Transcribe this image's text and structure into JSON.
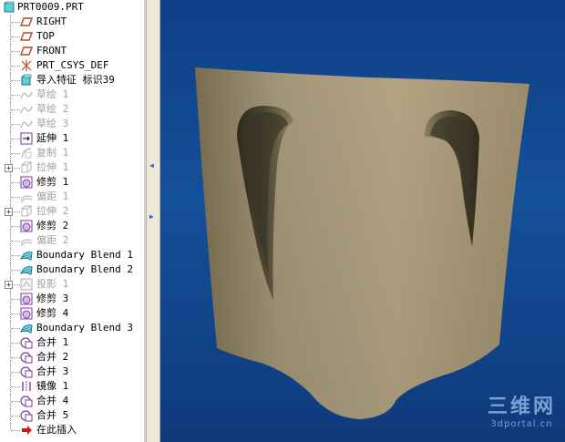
{
  "model_tree": {
    "root": "PRT0009.PRT",
    "items": [
      {
        "label": "RIGHT",
        "icon": "datum-plane-icon",
        "suppressed": false,
        "expandable": false
      },
      {
        "label": "TOP",
        "icon": "datum-plane-icon",
        "suppressed": false,
        "expandable": false
      },
      {
        "label": "FRONT",
        "icon": "datum-plane-icon",
        "suppressed": false,
        "expandable": false
      },
      {
        "label": "PRT_CSYS_DEF",
        "icon": "csys-icon",
        "suppressed": false,
        "expandable": false
      },
      {
        "label": "导入特征 标识39",
        "icon": "import-feature-icon",
        "suppressed": false,
        "expandable": false
      },
      {
        "label": "草绘 1",
        "icon": "sketch-icon",
        "suppressed": true,
        "expandable": false
      },
      {
        "label": "草绘 2",
        "icon": "sketch-icon",
        "suppressed": true,
        "expandable": false
      },
      {
        "label": "草绘 3",
        "icon": "sketch-icon",
        "suppressed": true,
        "expandable": false
      },
      {
        "label": "延伸 1",
        "icon": "extend-icon",
        "suppressed": false,
        "expandable": false
      },
      {
        "label": "复制 1",
        "icon": "copy-icon",
        "suppressed": true,
        "expandable": false
      },
      {
        "label": "拉伸 1",
        "icon": "extrude-icon",
        "suppressed": true,
        "expandable": true
      },
      {
        "label": "修剪 1",
        "icon": "trim-icon",
        "suppressed": false,
        "expandable": false
      },
      {
        "label": "偏距 1",
        "icon": "offset-icon",
        "suppressed": true,
        "expandable": false
      },
      {
        "label": "拉伸 2",
        "icon": "extrude-icon",
        "suppressed": true,
        "expandable": true
      },
      {
        "label": "修剪 2",
        "icon": "trim-icon",
        "suppressed": false,
        "expandable": false
      },
      {
        "label": "偏距 2",
        "icon": "offset-icon",
        "suppressed": true,
        "expandable": false
      },
      {
        "label": "Boundary Blend 1",
        "icon": "boundary-blend-icon",
        "suppressed": false,
        "expandable": false
      },
      {
        "label": "Boundary Blend 2",
        "icon": "boundary-blend-icon",
        "suppressed": false,
        "expandable": false
      },
      {
        "label": "投影 1",
        "icon": "project-icon",
        "suppressed": true,
        "expandable": true
      },
      {
        "label": "修剪 3",
        "icon": "trim-icon",
        "suppressed": false,
        "expandable": false
      },
      {
        "label": "修剪 4",
        "icon": "trim-icon",
        "suppressed": false,
        "expandable": false
      },
      {
        "label": "Boundary Blend 3",
        "icon": "boundary-blend-icon",
        "suppressed": false,
        "expandable": false
      },
      {
        "label": "合并 1",
        "icon": "merge-icon",
        "suppressed": false,
        "expandable": false
      },
      {
        "label": "合并 2",
        "icon": "merge-icon",
        "suppressed": false,
        "expandable": false
      },
      {
        "label": "合并 3",
        "icon": "merge-icon",
        "suppressed": false,
        "expandable": false
      },
      {
        "label": "镜像 1",
        "icon": "mirror-icon",
        "suppressed": false,
        "expandable": false
      },
      {
        "label": "合并 4",
        "icon": "merge-icon",
        "suppressed": false,
        "expandable": false
      },
      {
        "label": "合并 5",
        "icon": "merge-icon",
        "suppressed": false,
        "expandable": false
      },
      {
        "label": "在此插入",
        "icon": "insert-here-icon",
        "suppressed": false,
        "expandable": false
      }
    ]
  },
  "watermark": {
    "big": "三维网",
    "small": "3dportal.cn"
  },
  "colors": {
    "surface": "#a89a78",
    "background_top": "#0f3f86",
    "background_bottom": "#0f3a7c",
    "accent": "#8a2be2"
  }
}
